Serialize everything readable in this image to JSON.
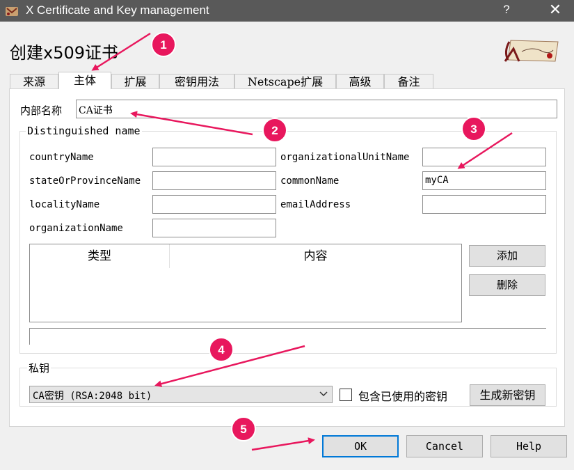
{
  "window": {
    "title": "X Certificate and Key management",
    "help_glyph": "?",
    "close_glyph": "✕",
    "icon": "app-icon"
  },
  "heading": "创建x509证书",
  "tabs": [
    {
      "label": "来源",
      "active": false
    },
    {
      "label": "主体",
      "active": true
    },
    {
      "label": "扩展",
      "active": false
    },
    {
      "label": "密钥用法",
      "active": false
    },
    {
      "label": "Netscape扩展",
      "active": false
    },
    {
      "label": "高级",
      "active": false
    },
    {
      "label": "备注",
      "active": false
    }
  ],
  "internal_name": {
    "label": "内部名称",
    "value": "CA证书"
  },
  "dn_group": {
    "title": "Distinguished name",
    "fields": {
      "countryName": {
        "label": "countryName",
        "value": ""
      },
      "stateOrProvinceName": {
        "label": "stateOrProvinceName",
        "value": ""
      },
      "localityName": {
        "label": "localityName",
        "value": ""
      },
      "organizationName": {
        "label": "organizationName",
        "value": ""
      },
      "organizationalUnitName": {
        "label": "organizationalUnitName",
        "value": ""
      },
      "commonName": {
        "label": "commonName",
        "value": "myCA"
      },
      "emailAddress": {
        "label": "emailAddress",
        "value": ""
      }
    },
    "table_headers": [
      "类型",
      "内容"
    ],
    "add_button": "添加",
    "delete_button": "删除"
  },
  "key_group": {
    "title": "私钥",
    "selected_key": "CA密钥 (RSA:2048 bit)",
    "include_used_label": "包含已使用的密钥",
    "include_used_checked": false,
    "generate_button": "生成新密钥"
  },
  "dialog_buttons": {
    "ok": "OK",
    "cancel": "Cancel",
    "help": "Help"
  },
  "annotations": {
    "color": "#e8175d",
    "badges": [
      "1",
      "2",
      "3",
      "4",
      "5"
    ]
  }
}
